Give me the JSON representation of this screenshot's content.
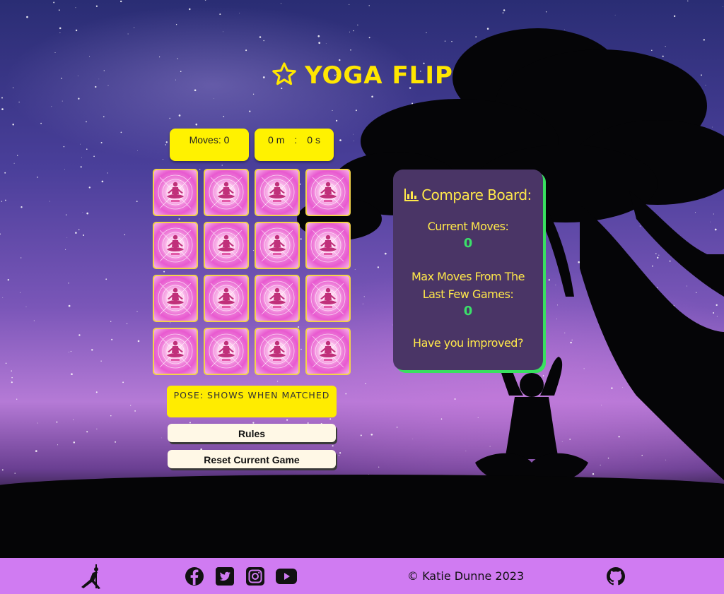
{
  "app": {
    "title": "YOGA FLIP"
  },
  "stats": {
    "moves_label": "Moves: 0",
    "minutes": "0 m",
    "separator": ":",
    "seconds": "0 s"
  },
  "cards": {
    "count": 16,
    "state": "face-down"
  },
  "pose": {
    "label": "POSE: SHOWS WHEN MATCHED"
  },
  "buttons": {
    "rules": "Rules",
    "reset": "Reset Current Game"
  },
  "board": {
    "title": "Compare Board:",
    "current_moves_label": "Current Moves:",
    "current_moves_value": "0",
    "max_moves_label": "Max Moves From The Last Few Games:",
    "max_moves_value": "0",
    "improved_label": "Have you improved?"
  },
  "footer": {
    "copyright": "© Katie Dunne 2023",
    "icons": [
      "yoga-pose-icon",
      "facebook-icon",
      "twitter-icon",
      "instagram-icon",
      "youtube-icon",
      "github-icon"
    ]
  },
  "colors": {
    "accent_yellow": "#ffe600",
    "board_bg": "#4a3566",
    "board_accent": "#38e05f",
    "footer_bg": "#d07bf2"
  }
}
